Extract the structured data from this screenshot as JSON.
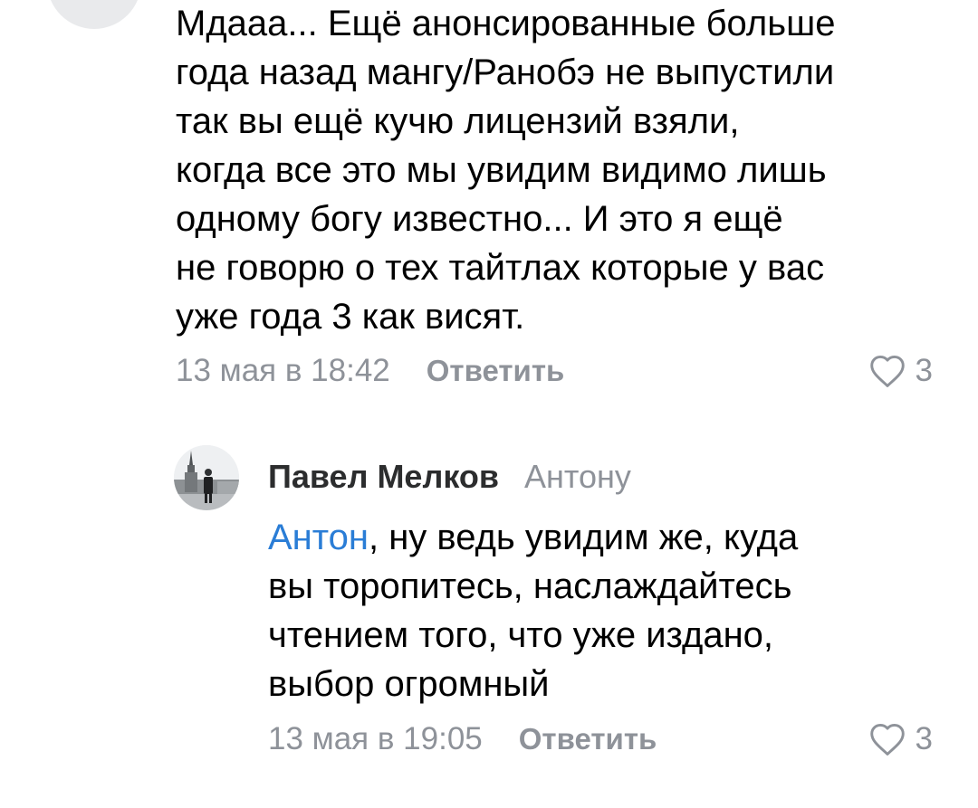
{
  "comments": [
    {
      "text": "Мдааа... Ещё анонсированные больше\nгода назад мангу/Ранобэ не выпустили\nтак вы ещё кучю лицензий взяли,\nкогда все это мы увидим видимо лишь\nодному богу известно... И это я ещё\nне говорю о тех тайтлах которые у вас\nуже года 3 как висят.",
      "date": "13 мая в 18:42",
      "reply_label": "Ответить",
      "likes": "3"
    },
    {
      "author": "Павел Мелков",
      "reply_to": "Антону",
      "mention": "Антон",
      "text": ", ну ведь увидим же, куда\nвы торопитесь, наслаждайтесь\nчтением того, что уже издано,\nвыбор огромный",
      "date": "13 мая в 19:05",
      "reply_label": "Ответить",
      "likes": "3"
    }
  ],
  "colors": {
    "text": "#000000",
    "secondary": "#8e9299",
    "link": "#2a7dd6",
    "author": "#2c2d2e"
  },
  "icons": {
    "like": "heart-outline-icon"
  }
}
